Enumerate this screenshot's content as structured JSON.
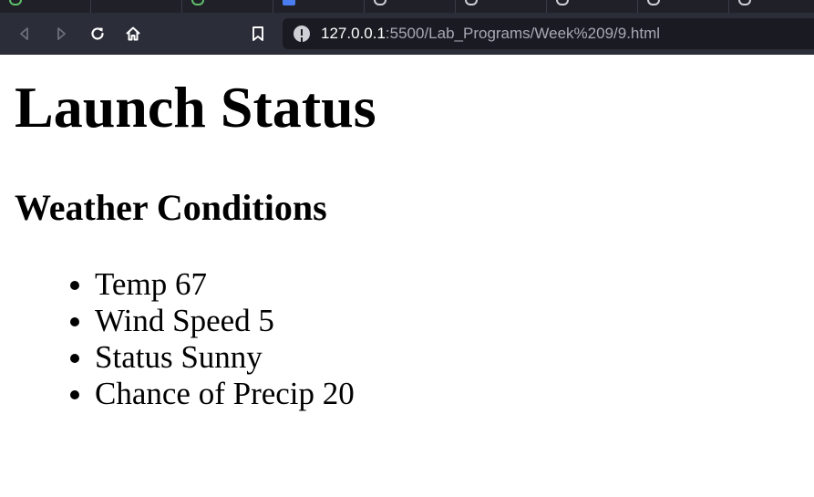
{
  "browser": {
    "address_bar": {
      "host": "127.0.0.1",
      "path": ":5500/Lab_Programs/Week%209/9.html"
    },
    "icons": {
      "back": "back-arrow-icon",
      "forward": "forward-arrow-icon",
      "reload": "reload-icon",
      "home": "home-icon",
      "bookmark": "bookmark-icon",
      "site_info": "info-icon"
    },
    "colors": {
      "tabstrip": "#1f2028",
      "toolbar": "#2b2d38",
      "address_bar": "#1a1b22"
    }
  },
  "page": {
    "title": "Launch Status",
    "section_heading": "Weather Conditions",
    "items": [
      "Temp 67",
      "Wind Speed 5",
      "Status Sunny",
      "Chance of Precip 20"
    ]
  }
}
